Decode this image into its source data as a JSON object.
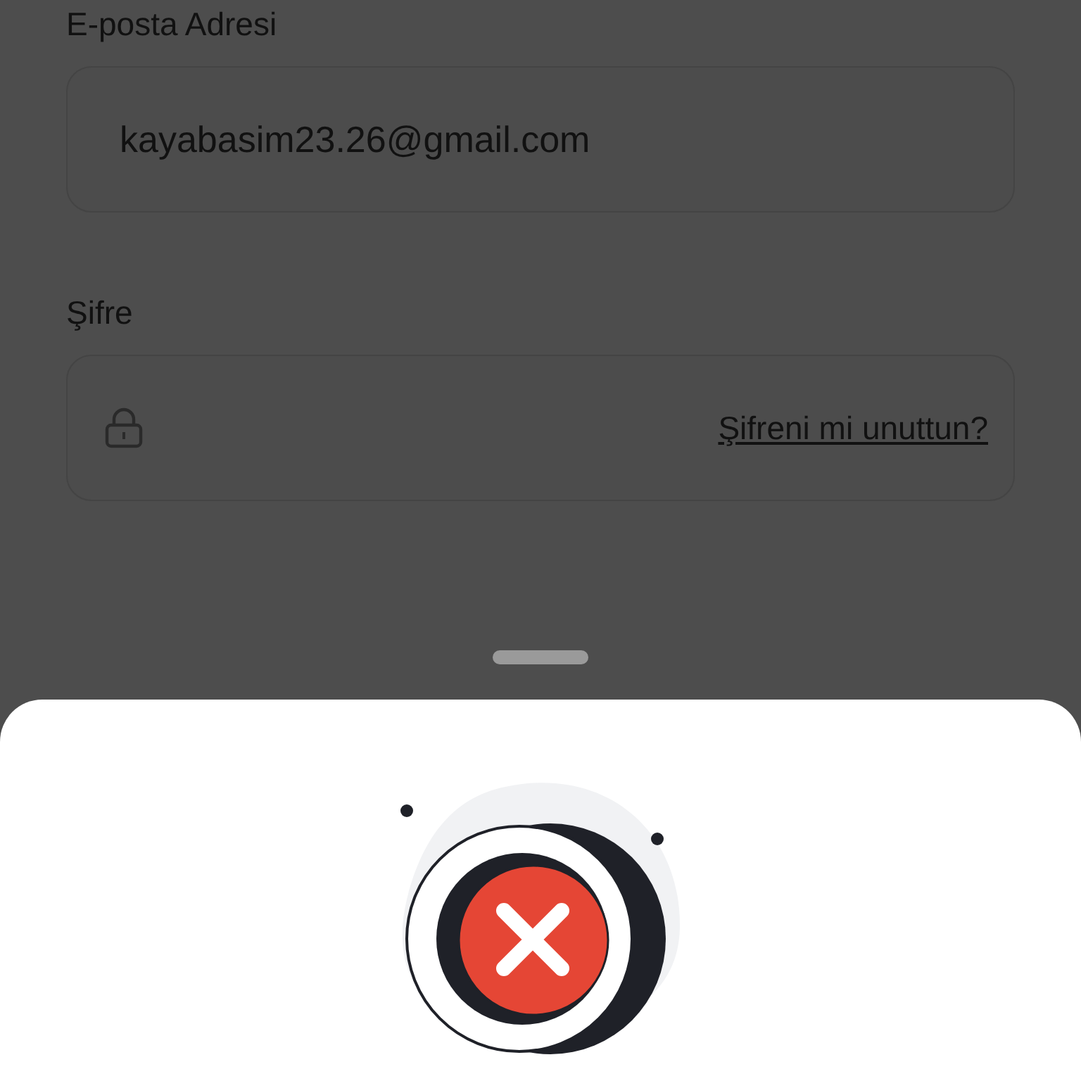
{
  "email_field": {
    "label": "E-posta Adresi",
    "value": "kayabasim23.26@gmail.com"
  },
  "password_field": {
    "label": "Şifre",
    "forgot_link": "Şifreni mi unuttun?"
  }
}
